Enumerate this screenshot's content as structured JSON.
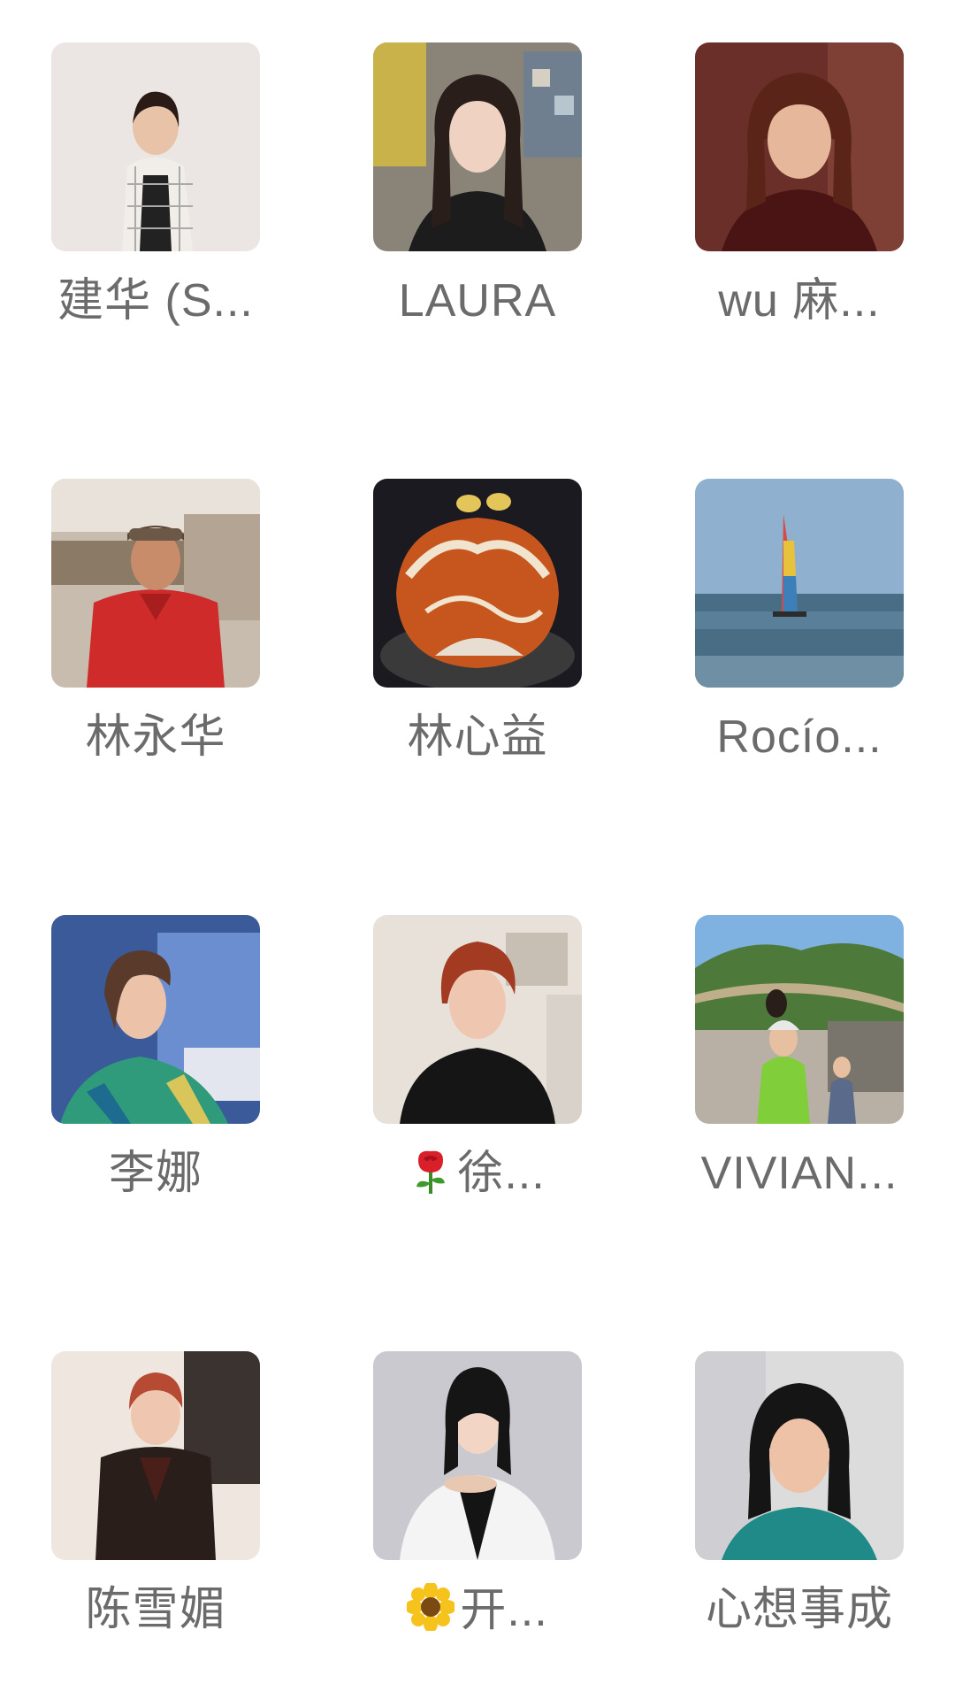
{
  "members": [
    {
      "name": "建华 (S..."
    },
    {
      "name": "LAURA"
    },
    {
      "name": "wu 麻..."
    },
    {
      "name": "林永华"
    },
    {
      "name": "林心益"
    },
    {
      "name": "Rocío..."
    },
    {
      "name": "李娜"
    },
    {
      "name": "徐...",
      "emoji": "rose"
    },
    {
      "name": "VIVIAN..."
    },
    {
      "name": "陈雪媚"
    },
    {
      "name": "开...",
      "emoji": "sunflower"
    },
    {
      "name": "心想事成"
    }
  ]
}
